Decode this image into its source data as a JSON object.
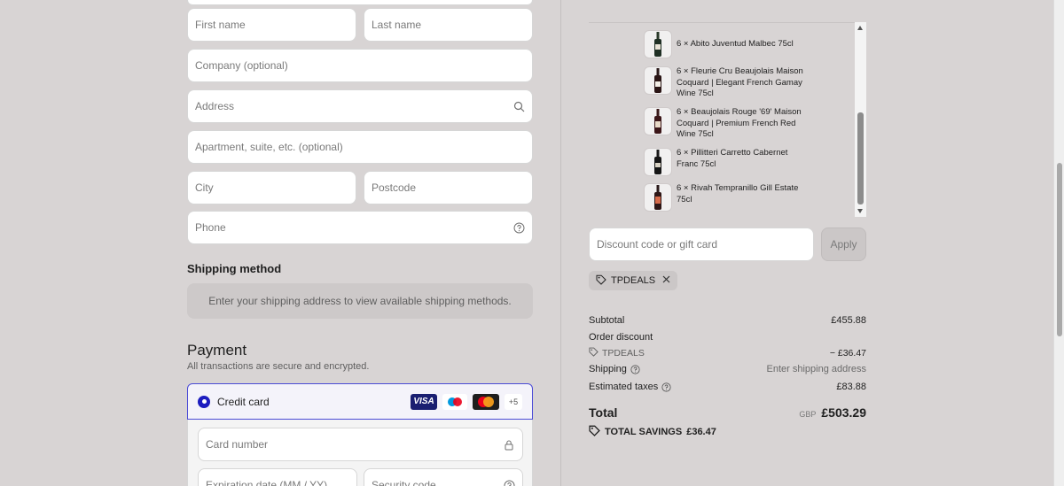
{
  "form": {
    "first_name_placeholder": "First name",
    "last_name_placeholder": "Last name",
    "company_placeholder": "Company (optional)",
    "address_placeholder": "Address",
    "apartment_placeholder": "Apartment, suite, etc. (optional)",
    "city_placeholder": "City",
    "postcode_placeholder": "Postcode",
    "phone_placeholder": "Phone"
  },
  "shipping": {
    "title": "Shipping method",
    "message": "Enter your shipping address to view available shipping methods."
  },
  "payment": {
    "title": "Payment",
    "subtitle": "All transactions are secure and encrypted.",
    "credit_card_label": "Credit card",
    "card_logos": {
      "visa": "VISA",
      "more": "+5"
    },
    "card_number_placeholder": "Card number",
    "expiry_placeholder": "Expiration date (MM / YY)",
    "security_placeholder": "Security code"
  },
  "cart": {
    "items": [
      {
        "label": "6 × Abito Juventud Malbec 75cl"
      },
      {
        "label": "6 × Fleurie Cru Beaujolais Maison Coquard | Elegant French Gamay Wine 75cl"
      },
      {
        "label": "6 × Beaujolais Rouge '69' Maison Coquard | Premium French Red Wine 75cl"
      },
      {
        "label": "6 × Pillitteri Carretto Cabernet Franc 75cl"
      },
      {
        "label": "6 × Rivah Tempranillo Gill Estate 75cl"
      }
    ]
  },
  "discount": {
    "placeholder": "Discount code or gift card",
    "apply_label": "Apply",
    "applied_code": "TPDEALS"
  },
  "summary": {
    "subtotal_label": "Subtotal",
    "subtotal_value": "£455.88",
    "order_discount_label": "Order discount",
    "discount_code": "TPDEALS",
    "discount_value": "− £36.47",
    "shipping_label": "Shipping",
    "shipping_value": "Enter shipping address",
    "taxes_label": "Estimated taxes",
    "taxes_value": "£83.88",
    "total_label": "Total",
    "currency": "GBP",
    "total_value": "£503.29",
    "savings_label": "TOTAL SAVINGS",
    "savings_value": "£36.47"
  }
}
